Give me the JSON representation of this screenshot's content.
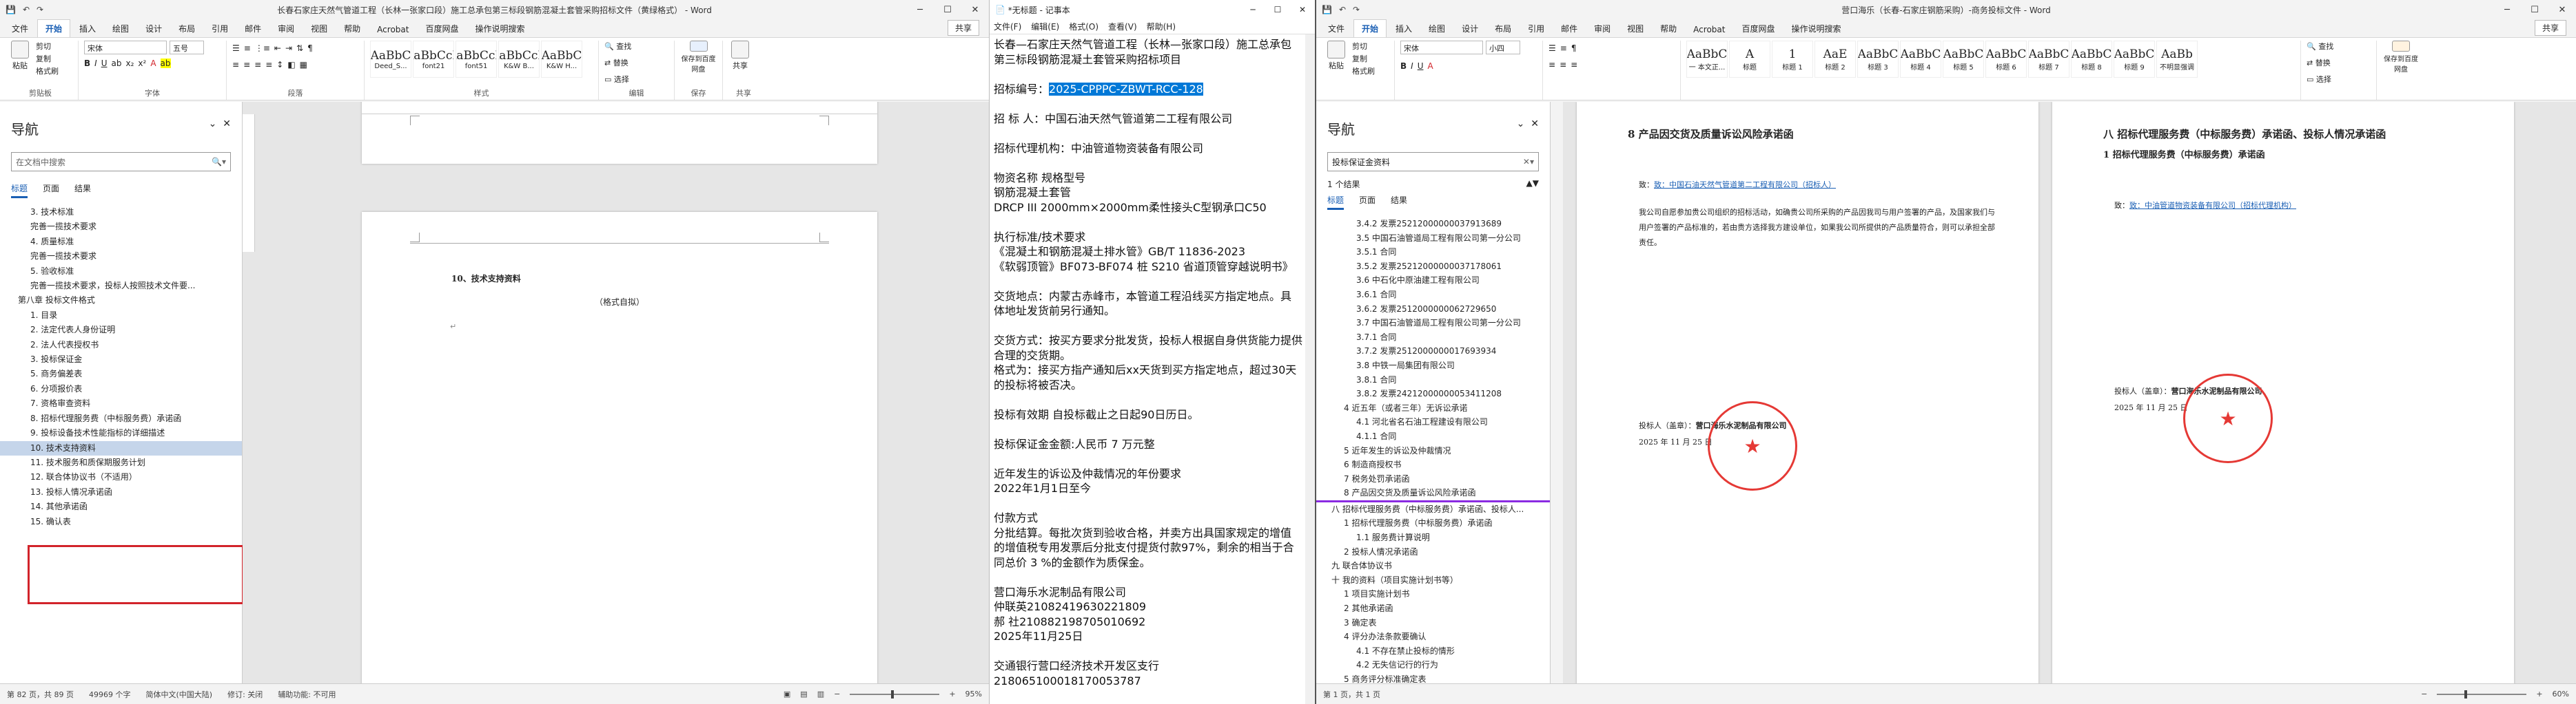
{
  "word1": {
    "title": "长春石家庄天然气管道工程（长林一张家口段）施工总承包第三标段钢筋混凝土套管采购招标文件（黄绿格式） - Word",
    "share": "共享",
    "tabs": [
      "文件",
      "开始",
      "插入",
      "绘图",
      "设计",
      "布局",
      "引用",
      "邮件",
      "审阅",
      "视图",
      "帮助",
      "Acrobat",
      "百度网盘",
      "操作说明搜索"
    ],
    "ribbon": {
      "paste": "粘贴",
      "clipboard": [
        "剪切",
        "复制",
        "格式刷"
      ],
      "font_name": "宋体",
      "font_size": "五号",
      "styles": [
        {
          "sample": "AaBbC",
          "name": "Deed_S..."
        },
        {
          "sample": "AaBbCcD",
          "name": "font21"
        },
        {
          "sample": "AaBbCcD",
          "name": "font51"
        },
        {
          "sample": "AaBbCcD",
          "name": "K&W B..."
        },
        {
          "sample": "AaBbC",
          "name": "K&W H..."
        }
      ],
      "find": "查找",
      "replace": "替换",
      "select": "选择",
      "save_baidu": "保存到百度网盘",
      "share": "共享",
      "groups": [
        "剪贴板",
        "字体",
        "段落",
        "样式",
        "编辑",
        "保存",
        "共享"
      ]
    },
    "nav": {
      "title": "导航",
      "search_placeholder": "在文档中搜索",
      "tabs": [
        "标题",
        "页面",
        "结果"
      ],
      "items": [
        "3. 技术标准",
        "完善一揽技术要求",
        "4. 质量标准",
        "完善一揽技术要求",
        "5. 验收标准",
        "完善一揽技术要求，投标人按照技术文件要...",
        "第八章  投标文件格式",
        "1. 目录",
        "",
        "2. 法定代表人身份证明",
        "2. 法人代表授权书",
        "3. 投标保证金",
        "",
        "",
        "5. 商务偏差表",
        "6. 分项报价表",
        "",
        "",
        "7. 资格审查资料",
        "",
        "",
        "8. 招标代理服务费（中标服务费）承诺函",
        "9. 投标设备技术性能指标的详细描述",
        "10. 技术支持资料",
        "11. 技术服务和质保期服务计划",
        "12. 联合体协议书（不适用）",
        "",
        "13. 投标人情况承诺函",
        "14. 其他承诺函",
        "15. 确认表"
      ]
    },
    "doc": {
      "heading": "10、技术支持资料",
      "sub": "（格式自拟）"
    },
    "status": {
      "page": "第 82 页，共 89 页",
      "words": "49969 个字",
      "lang": "简体中文(中国大陆)",
      "track": "修订: 关闭",
      "access": "辅助功能: 不可用",
      "zoom": "95%"
    }
  },
  "notepad": {
    "title": "*无标题 - 记事本",
    "menu": [
      "文件(F)",
      "编辑(E)",
      "格式(O)",
      "查看(V)",
      "帮助(H)"
    ],
    "lines": [
      "长春—石家庄天然气管道工程（长林—张家口段）施工总承包",
      "第三标段钢筋混凝土套管采购招标项目",
      "",
      "招标编号：2025-CPPPC-ZBWT-RCC-128",
      "",
      "招 标 人：中国石油天然气管道第二工程有限公司",
      "",
      "招标代理机构：中油管道物资装备有限公司",
      "",
      "物资名称   规格型号",
      "钢筋混凝土套管",
      "DRCP III 2000mm×2000mm柔性接头C型钢承口C50",
      "",
      "执行标准/技术要求",
      "《混凝土和钢筋混凝土排水管》GB/T 11836-2023",
      "《软弱顶管》BF073-BF074 桩 S210 省道顶管穿越说明书》",
      "",
      "交货地点：内蒙古赤峰市，本管道工程沿线买方指定地点。具",
      "体地址发货前另行通知。",
      "",
      "交货方式：按买方要求分批发货，投标人根据自身供货能力提供",
      "合理的交货期。",
      "格式为：接买方指产通知后xx天货到买方指定地点，超过30天",
      "的投标将被否决。",
      "",
      "投标有效期  自投标截止之日起90日历日。",
      "",
      "投标保证金金额:人民币 7 万元整",
      "",
      "近年发生的诉讼及仲裁情况的年份要求",
      "2022年1月1日至今",
      "",
      "付款方式",
      "分批结算。每批次货到验收合格，并卖方出具国家规定的增值",
      "的增值税专用发票后分批支付提货付款97%，剩余的相当于合",
      "同总价 3 %的金额作为质保金。",
      "",
      "营口海乐水泥制品有限公司",
      "仲联英21082419630221809",
      "郝  社21088219870501069​2",
      "2025年11月25日",
      "",
      "交通银行营口经济技术开发区支行",
      "21806510001817005378​7"
    ],
    "selected": "2025-CPPPC-ZBWT-RCC-128"
  },
  "word2": {
    "title": "营口海乐（长春-石家庄钢筋采购）-商务投标文件 - Word",
    "share": "共享",
    "tabs": [
      "文件",
      "开始",
      "插入",
      "绘图",
      "设计",
      "布局",
      "引用",
      "邮件",
      "审阅",
      "视图",
      "帮助",
      "Acrobat",
      "百度网盘",
      "操作说明搜索"
    ],
    "styles": [
      {
        "sample": "AaBbC",
        "name": "一 本文正..."
      },
      {
        "sample": "A",
        "name": "标题"
      },
      {
        "sample": "1",
        "name": "标题 1"
      },
      {
        "sample": "AaE",
        "name": "标题 2"
      },
      {
        "sample": "AaBbC",
        "name": "标题 3"
      },
      {
        "sample": "AaBbC",
        "name": "标题 4"
      },
      {
        "sample": "AaBbC",
        "name": "标题 5"
      },
      {
        "sample": "AaBbC",
        "name": "标题 6"
      },
      {
        "sample": "AaBbC",
        "name": "标题 7"
      },
      {
        "sample": "AaBbC",
        "name": "标题 8"
      },
      {
        "sample": "AaBbC",
        "name": "标题 9"
      },
      {
        "sample": "AaBb",
        "name": "不明显强调"
      }
    ],
    "nav": {
      "title": "导航",
      "search_value": "投标保证金资料",
      "count": "1 个结果",
      "tabs": [
        "标题",
        "页面",
        "结果"
      ],
      "items": [
        "3.4.2 发票25212000000037913689",
        "3.5 中国石油管道局工程有限公司第一分公司",
        "3.5.1 合同",
        "3.5.2 发票25212000000037178061",
        "3.6 中石化中原油建工程有限公司",
        "3.6.1 合同",
        "3.6.2 发票2512000000062729650",
        "3.7 中国石油管道局工程有限公司第一分公司",
        "3.7.1 合同",
        "3.7.2 发票2512000000017693934",
        "3.8 中铁一局集团有限公司",
        "3.8.1 合同",
        "3.8.2 发票24212000000053411208",
        "4 近五年（或者三年）无诉讼承诺",
        "4.1 河北省名石油工程建设有限公司",
        "4.1.1 合同",
        "5 近年发生的诉讼及仲裁情况",
        "6 制造商授权书",
        "7 税务处罚承诺函",
        "8 产品因交货及质量诉讼风险承诺函",
        "八 招标代理服务费（中标服务费）承诺函、投标人...",
        "1 招标代理服务费（中标服务费）承诺函",
        "1.1 服务费计算说明",
        "2 投标人情况承诺函",
        "九 联合体协议书",
        "十 我的资料（项目实施计划书等）",
        "1 项目实施计划书",
        "2 其他承诺函",
        "3 确定表",
        "4 评分办法条款要确认",
        "4.1 不存在禁止投标的情形",
        "4.2 无失信记行的行为",
        "5 商务评分标准确定表"
      ]
    },
    "page1": {
      "heading": "8 产品因交货及质量诉讼风险承诺函",
      "to": "致：中国石油天然气管道第二工程有限公司（招标人）",
      "body": "我公司自愿参加贵公司组织的招标活动，如确贵公司所采购的产品因我司与用户签署的产品，及国家我们与用户签署的产品标准的，若由贵方选择我方建设单位，如果我公司所提供的产品质量符合，则可以承担全部责任。",
      "sign_label": "投标人（盖章）：",
      "company": "营口海乐水泥制品有限公司",
      "date": "2025 年 11 月 25 日"
    },
    "page2": {
      "heading": "八 招标代理服务费（中标服务费）承诺函、投标人情况承诺函",
      "sub": "1 招标代理服务费（中标服务费）承诺函",
      "to": "致：中油管道物资装备有限公司（招标代理机构）",
      "sign_label": "投标人（盖章）：",
      "company": "营口海乐水泥制品有限公司",
      "date": "2025 年 11 月 25 日"
    },
    "status": {
      "page": "第 1 页，共 1 页",
      "zoom": "60%"
    }
  }
}
